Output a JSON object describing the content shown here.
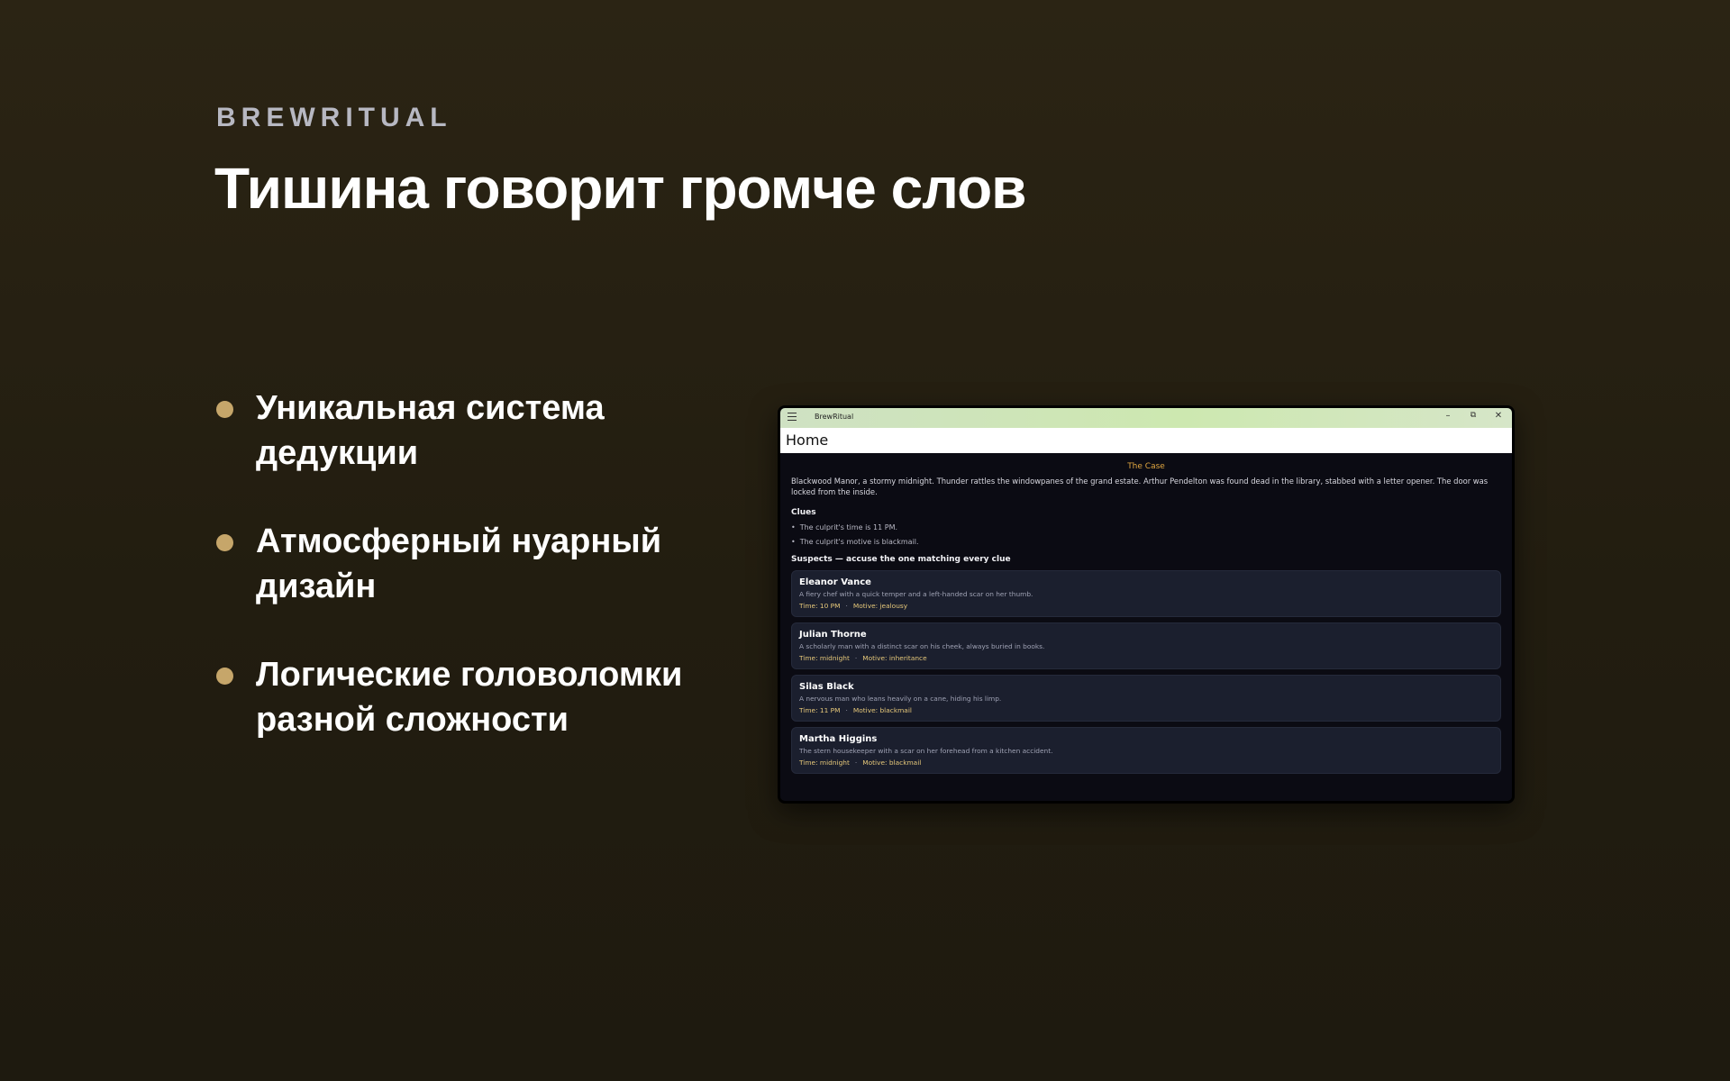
{
  "brand": "BREWRITUAL",
  "headline": "Тишина говорит громче слов",
  "features": [
    "Уникальная система дедукции",
    "Атмосферный нуарный дизайн",
    "Логические головоломки разной сложности"
  ],
  "window": {
    "title": "BrewRitual",
    "controls": {
      "minimize": "–",
      "maximize": "⧉",
      "close": "✕"
    },
    "page_title": "Home",
    "case_title": "The Case",
    "case_text": "Blackwood Manor, a stormy midnight. Thunder rattles the windowpanes of the grand estate. Arthur Pendelton was found dead in the library, stabbed with a letter opener. The door was locked from the inside.",
    "clues_title": "Clues",
    "clues": [
      "The culprit's time is 11 PM.",
      "The culprit's motive is blackmail."
    ],
    "suspects_title": "Suspects — accuse the one matching every clue",
    "suspects": [
      {
        "name": "Eleanor Vance",
        "desc": "A fiery chef with a quick temper and a left-handed scar on her thumb.",
        "time": "Time: 10 PM",
        "motive": "Motive: jealousy"
      },
      {
        "name": "Julian Thorne",
        "desc": "A scholarly man with a distinct scar on his cheek, always buried in books.",
        "time": "Time: midnight",
        "motive": "Motive: inheritance"
      },
      {
        "name": "Silas Black",
        "desc": "A nervous man who leans heavily on a cane, hiding his limp.",
        "time": "Time: 11 PM",
        "motive": "Motive: blackmail"
      },
      {
        "name": "Martha Higgins",
        "desc": "The stern housekeeper with a scar on her forehead from a kitchen accident.",
        "time": "Time: midnight",
        "motive": "Motive: blackmail"
      }
    ]
  },
  "colors": {
    "accent_bullet": "#c6a66a",
    "case_title": "#e0a640",
    "suspect_meta": "#e6c87a"
  }
}
